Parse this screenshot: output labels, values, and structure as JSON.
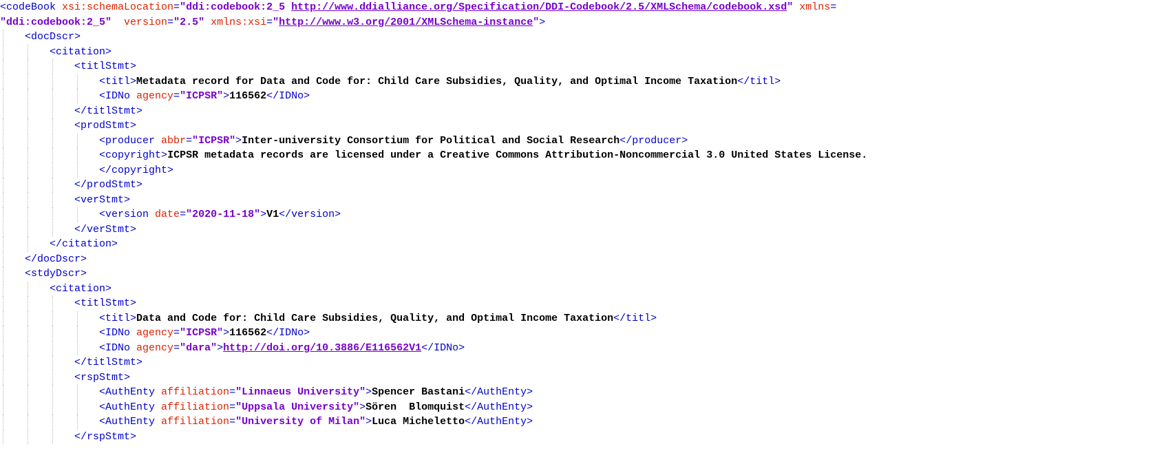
{
  "document": {
    "type": "xml-tree-view",
    "root_element": "codeBook",
    "colors": {
      "tag": "#0000cc",
      "attribute_name": "#dd2200",
      "attribute_value": "#7700cc",
      "text_content": "#000000",
      "link": "#7700cc",
      "background": "#ffffff",
      "indent_guide": "#b9b9b9"
    }
  },
  "lines": [
    {
      "indent": 0,
      "parts": [
        {
          "kind": "tag",
          "text": "<codeBook "
        },
        {
          "kind": "attname",
          "text": "xsi:schemaLocation"
        },
        {
          "kind": "tag",
          "text": "="
        },
        {
          "kind": "attval",
          "text": "\"ddi:codebook:2_5 "
        },
        {
          "kind": "link",
          "text": "http://www.ddialliance.org/Specification/DDI-Codebook/2.5/XMLSchema/codebook.xsd"
        },
        {
          "kind": "attval",
          "text": "\""
        },
        {
          "kind": "tag",
          "text": " "
        },
        {
          "kind": "attname",
          "text": "xmlns"
        },
        {
          "kind": "tag",
          "text": "="
        }
      ]
    },
    {
      "indent": 0,
      "parts": [
        {
          "kind": "attval",
          "text": "\"ddi:codebook:2_5\""
        },
        {
          "kind": "tag",
          "text": "  "
        },
        {
          "kind": "attname",
          "text": "version"
        },
        {
          "kind": "tag",
          "text": "="
        },
        {
          "kind": "attval",
          "text": "\"2.5\""
        },
        {
          "kind": "tag",
          "text": " "
        },
        {
          "kind": "attname",
          "text": "xmlns:xsi"
        },
        {
          "kind": "tag",
          "text": "="
        },
        {
          "kind": "attval",
          "text": "\""
        },
        {
          "kind": "link",
          "text": "http://www.w3.org/2001/XMLSchema-instance"
        },
        {
          "kind": "attval",
          "text": "\""
        },
        {
          "kind": "tag",
          "text": ">"
        }
      ]
    },
    {
      "indent": 1,
      "parts": [
        {
          "kind": "tag",
          "text": "<docDscr>"
        }
      ]
    },
    {
      "indent": 2,
      "parts": [
        {
          "kind": "tag",
          "text": "<citation>"
        }
      ]
    },
    {
      "indent": 3,
      "parts": [
        {
          "kind": "tag",
          "text": "<titlStmt>"
        }
      ]
    },
    {
      "indent": 4,
      "parts": [
        {
          "kind": "tag",
          "text": "<titl>"
        },
        {
          "kind": "txt",
          "text": "Metadata record for Data and Code for: Child Care Subsidies, Quality, and Optimal Income Taxation"
        },
        {
          "kind": "tag",
          "text": "</titl>"
        }
      ]
    },
    {
      "indent": 4,
      "parts": [
        {
          "kind": "tag",
          "text": "<IDNo "
        },
        {
          "kind": "attname",
          "text": "agency"
        },
        {
          "kind": "tag",
          "text": "="
        },
        {
          "kind": "attval",
          "text": "\"ICPSR\""
        },
        {
          "kind": "tag",
          "text": ">"
        },
        {
          "kind": "txt",
          "text": "116562"
        },
        {
          "kind": "tag",
          "text": "</IDNo>"
        }
      ]
    },
    {
      "indent": 3,
      "parts": [
        {
          "kind": "tag",
          "text": "</titlStmt>"
        }
      ]
    },
    {
      "indent": 3,
      "parts": [
        {
          "kind": "tag",
          "text": "<prodStmt>"
        }
      ]
    },
    {
      "indent": 4,
      "parts": [
        {
          "kind": "tag",
          "text": "<producer "
        },
        {
          "kind": "attname",
          "text": "abbr"
        },
        {
          "kind": "tag",
          "text": "="
        },
        {
          "kind": "attval",
          "text": "\"ICPSR\""
        },
        {
          "kind": "tag",
          "text": ">"
        },
        {
          "kind": "txt",
          "text": "Inter-university Consortium for Political and Social Research"
        },
        {
          "kind": "tag",
          "text": "</producer>"
        }
      ]
    },
    {
      "indent": 4,
      "parts": [
        {
          "kind": "tag",
          "text": "<copyright>"
        },
        {
          "kind": "txt",
          "text": "ICPSR metadata records are licensed under a Creative Commons Attribution-Noncommercial 3.0 United States License."
        }
      ]
    },
    {
      "indent": 4,
      "parts": [
        {
          "kind": "tag",
          "text": "</copyright>"
        }
      ]
    },
    {
      "indent": 3,
      "parts": [
        {
          "kind": "tag",
          "text": "</prodStmt>"
        }
      ]
    },
    {
      "indent": 3,
      "parts": [
        {
          "kind": "tag",
          "text": "<verStmt>"
        }
      ]
    },
    {
      "indent": 4,
      "parts": [
        {
          "kind": "tag",
          "text": "<version "
        },
        {
          "kind": "attname",
          "text": "date"
        },
        {
          "kind": "tag",
          "text": "="
        },
        {
          "kind": "attval",
          "text": "\"2020-11-18\""
        },
        {
          "kind": "tag",
          "text": ">"
        },
        {
          "kind": "txt",
          "text": "V1"
        },
        {
          "kind": "tag",
          "text": "</version>"
        }
      ]
    },
    {
      "indent": 3,
      "parts": [
        {
          "kind": "tag",
          "text": "</verStmt>"
        }
      ]
    },
    {
      "indent": 2,
      "parts": [
        {
          "kind": "tag",
          "text": "</citation>"
        }
      ]
    },
    {
      "indent": 1,
      "parts": [
        {
          "kind": "tag",
          "text": "</docDscr>"
        }
      ]
    },
    {
      "indent": 1,
      "parts": [
        {
          "kind": "tag",
          "text": "<stdyDscr>"
        }
      ]
    },
    {
      "indent": 2,
      "parts": [
        {
          "kind": "tag",
          "text": "<citation>"
        }
      ]
    },
    {
      "indent": 3,
      "parts": [
        {
          "kind": "tag",
          "text": "<titlStmt>"
        }
      ]
    },
    {
      "indent": 4,
      "parts": [
        {
          "kind": "tag",
          "text": "<titl>"
        },
        {
          "kind": "txt",
          "text": "Data and Code for: Child Care Subsidies, Quality, and Optimal Income Taxation"
        },
        {
          "kind": "tag",
          "text": "</titl>"
        }
      ]
    },
    {
      "indent": 4,
      "parts": [
        {
          "kind": "tag",
          "text": "<IDNo "
        },
        {
          "kind": "attname",
          "text": "agency"
        },
        {
          "kind": "tag",
          "text": "="
        },
        {
          "kind": "attval",
          "text": "\"ICPSR\""
        },
        {
          "kind": "tag",
          "text": ">"
        },
        {
          "kind": "txt",
          "text": "116562"
        },
        {
          "kind": "tag",
          "text": "</IDNo>"
        }
      ]
    },
    {
      "indent": 4,
      "parts": [
        {
          "kind": "tag",
          "text": "<IDNo "
        },
        {
          "kind": "attname",
          "text": "agency"
        },
        {
          "kind": "tag",
          "text": "="
        },
        {
          "kind": "attval",
          "text": "\"dara\""
        },
        {
          "kind": "tag",
          "text": ">"
        },
        {
          "kind": "linktext",
          "text": "http://doi.org/10.3886/E116562V1"
        },
        {
          "kind": "tag",
          "text": "</IDNo>"
        }
      ]
    },
    {
      "indent": 3,
      "parts": [
        {
          "kind": "tag",
          "text": "</titlStmt>"
        }
      ]
    },
    {
      "indent": 3,
      "parts": [
        {
          "kind": "tag",
          "text": "<rspStmt>"
        }
      ]
    },
    {
      "indent": 4,
      "parts": [
        {
          "kind": "tag",
          "text": "<AuthEnty "
        },
        {
          "kind": "attname",
          "text": "affiliation"
        },
        {
          "kind": "tag",
          "text": "="
        },
        {
          "kind": "attval",
          "text": "\"Linnaeus University\""
        },
        {
          "kind": "tag",
          "text": ">"
        },
        {
          "kind": "txt",
          "text": "Spencer Bastani"
        },
        {
          "kind": "tag",
          "text": "</AuthEnty>"
        }
      ]
    },
    {
      "indent": 4,
      "parts": [
        {
          "kind": "tag",
          "text": "<AuthEnty "
        },
        {
          "kind": "attname",
          "text": "affiliation"
        },
        {
          "kind": "tag",
          "text": "="
        },
        {
          "kind": "attval",
          "text": "\"Uppsala University\""
        },
        {
          "kind": "tag",
          "text": ">"
        },
        {
          "kind": "txt",
          "text": "Sören  Blomquist"
        },
        {
          "kind": "tag",
          "text": "</AuthEnty>"
        }
      ]
    },
    {
      "indent": 4,
      "parts": [
        {
          "kind": "tag",
          "text": "<AuthEnty "
        },
        {
          "kind": "attname",
          "text": "affiliation"
        },
        {
          "kind": "tag",
          "text": "="
        },
        {
          "kind": "attval",
          "text": "\"University of Milan\""
        },
        {
          "kind": "tag",
          "text": ">"
        },
        {
          "kind": "txt",
          "text": "Luca Micheletto"
        },
        {
          "kind": "tag",
          "text": "</AuthEnty>"
        }
      ]
    },
    {
      "indent": 3,
      "parts": [
        {
          "kind": "tag",
          "text": "</rspStmt>"
        }
      ]
    }
  ]
}
